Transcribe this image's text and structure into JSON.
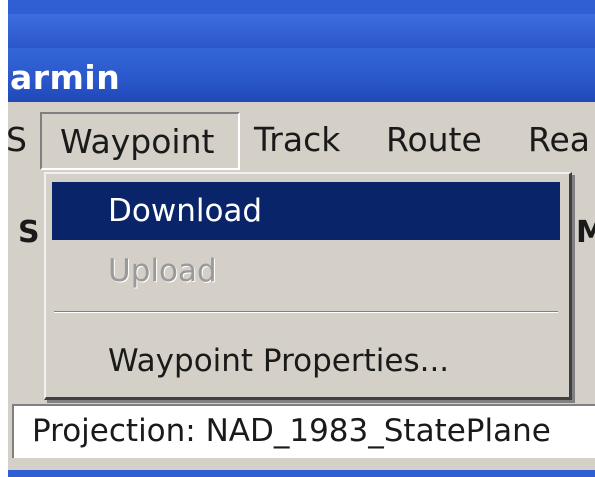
{
  "window": {
    "title": "armin"
  },
  "menubar": {
    "left_fragment": "S",
    "items": [
      {
        "label": "Waypoint",
        "open": true
      },
      {
        "label": "Track"
      },
      {
        "label": "Route"
      },
      {
        "label": "Rea"
      }
    ]
  },
  "waypoint_menu": {
    "items": [
      {
        "label": "Download",
        "state": "selected"
      },
      {
        "label": "Upload",
        "state": "disabled"
      },
      {
        "label": "Waypoint Properties...",
        "state": "normal"
      }
    ]
  },
  "background": {
    "left_letter": "S",
    "right_letter": "M"
  },
  "status": {
    "projection": "Projection: NAD_1983_StatePlane"
  },
  "colors": {
    "title_bar": "#2a57c9",
    "highlight": "#0a246a",
    "face": "#d4d0c8"
  }
}
